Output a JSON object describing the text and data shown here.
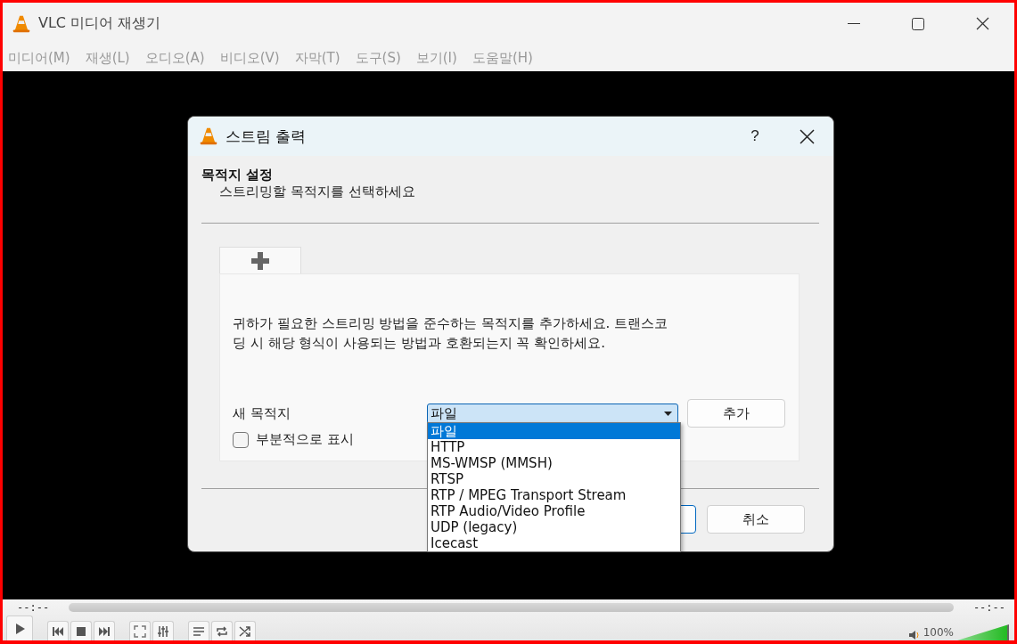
{
  "window": {
    "title": "VLC 미디어 재생기"
  },
  "menu": [
    "미디어(M)",
    "재생(L)",
    "오디오(A)",
    "비디오(V)",
    "자막(T)",
    "도구(S)",
    "보기(I)",
    "도움말(H)"
  ],
  "dialog": {
    "title": "스트림 출력",
    "help": "?",
    "heading": "목적지 설정",
    "subheading": "스트리밍할 목적지를 선택하세요",
    "tab": {
      "selected": true
    },
    "description": "귀하가 필요한 스트리밍 방법을 준수하는 목적지를 추가하세요. 트랜스코딩 시 해당 형식이 사용되는 방법과 호환되는지 꼭 확인하세요.",
    "destination_label": "새 목적지",
    "destination_value": "파일",
    "add_button": "추가",
    "partial_checkbox": {
      "label": "부분적으로 표시",
      "checked": false
    },
    "dropdown_options": [
      {
        "label": "파일",
        "selected": true
      },
      {
        "label": "HTTP",
        "selected": false
      },
      {
        "label": "MS-WMSP (MMSH)",
        "selected": false
      },
      {
        "label": "RTSP",
        "selected": false
      },
      {
        "label": "RTP / MPEG Transport Stream",
        "selected": false
      },
      {
        "label": "RTP Audio/Video Profile",
        "selected": false
      },
      {
        "label": "UDP (legacy)",
        "selected": false
      },
      {
        "label": "Icecast",
        "selected": false
      }
    ],
    "cancel_button": "취소"
  },
  "player": {
    "elapsed": "--:--",
    "remaining": "--:--",
    "seek": {
      "level": 0
    },
    "volume": {
      "label": "100%",
      "level": 1
    }
  }
}
